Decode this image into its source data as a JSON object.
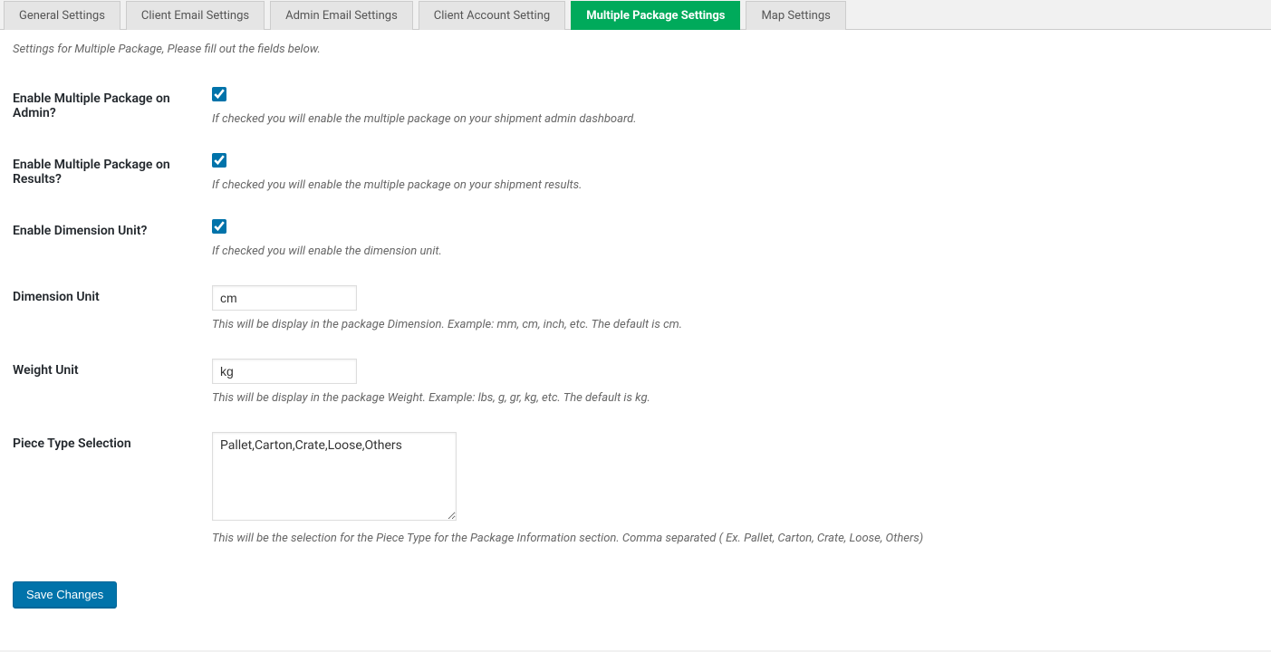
{
  "tabs": [
    {
      "label": "General Settings",
      "active": false
    },
    {
      "label": "Client Email Settings",
      "active": false
    },
    {
      "label": "Admin Email Settings",
      "active": false
    },
    {
      "label": "Client Account Setting",
      "active": false
    },
    {
      "label": "Multiple Package Settings",
      "active": true
    },
    {
      "label": "Map Settings",
      "active": false
    }
  ],
  "intro": "Settings for Multiple Package, Please fill out the fields below.",
  "fields": {
    "enable_admin": {
      "label": "Enable Multiple Package on Admin?",
      "checked": true,
      "desc": "If checked you will enable the multiple package on your shipment admin dashboard."
    },
    "enable_results": {
      "label": "Enable Multiple Package on Results?",
      "checked": true,
      "desc": "If checked you will enable the multiple package on your shipment results."
    },
    "enable_dim_unit": {
      "label": "Enable Dimension Unit?",
      "checked": true,
      "desc": "If checked you will enable the dimension unit."
    },
    "dim_unit": {
      "label": "Dimension Unit",
      "value": "cm",
      "desc": "This will be display in the package Dimension. Example: mm, cm, inch, etc. The default is cm."
    },
    "weight_unit": {
      "label": "Weight Unit",
      "value": "kg",
      "desc": "This will be display in the package Weight. Example: lbs, g, gr, kg, etc. The default is kg."
    },
    "piece_type": {
      "label": "Piece Type Selection",
      "value": "Pallet,Carton,Crate,Loose,Others",
      "desc": "This will be the selection for the Piece Type for the Package Information section. Comma separated ( Ex. Pallet, Carton, Crate, Loose, Others)"
    }
  },
  "submit_label": "Save Changes"
}
